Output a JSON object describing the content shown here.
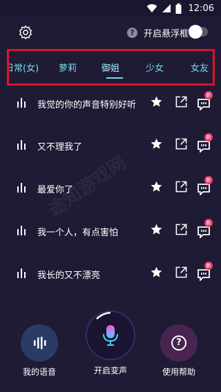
{
  "status_bar": {
    "time": "12:06"
  },
  "header": {
    "float_toggle_label": "开启悬浮框",
    "help_glyph": "?"
  },
  "tabs": [
    {
      "label": "日常(女)"
    },
    {
      "label": "萝莉"
    },
    {
      "label": "御姐"
    },
    {
      "label": "少女"
    },
    {
      "label": "女友"
    }
  ],
  "active_tab": "御姐",
  "list": [
    {
      "text": "我觉的你的声音特别好听",
      "badge": "新"
    },
    {
      "text": "又不理我了",
      "badge": "新"
    },
    {
      "text": "最爱你了",
      "badge": "新"
    },
    {
      "text": "我一个人，有点害怕",
      "badge": "新"
    },
    {
      "text": "我长的又不漂亮",
      "badge": "新"
    }
  ],
  "bottom": {
    "my_voice_label": "我的语音",
    "start_voice_change_label": "开启变声",
    "help_label": "使用帮助",
    "help_glyph": "?"
  },
  "watermark": "途知游戏网",
  "colors": {
    "background": "#1f1b35",
    "tab_text": "#7bd8e8",
    "highlight_box": "#e0122a",
    "badge": "#e83a6a"
  }
}
